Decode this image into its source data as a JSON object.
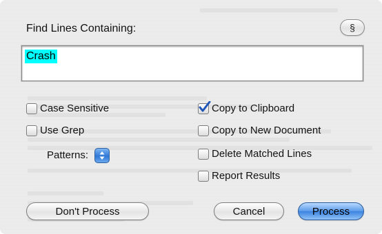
{
  "dialog": {
    "title_label": "Find Lines Containing:",
    "section_button": "§",
    "find_value": "Crash"
  },
  "options_left": {
    "case_sensitive": {
      "label": "Case Sensitive",
      "checked": false
    },
    "use_grep": {
      "label": "Use Grep",
      "checked": false
    },
    "patterns_label": "Patterns:"
  },
  "options_right": {
    "copy_to_clipboard": {
      "label": "Copy to Clipboard",
      "checked": true
    },
    "copy_to_new_document": {
      "label": "Copy to New Document",
      "checked": false
    },
    "delete_matched_lines": {
      "label": "Delete Matched Lines",
      "checked": false
    },
    "report_results": {
      "label": "Report Results",
      "checked": false
    }
  },
  "buttons": {
    "dont_process": "Don't Process",
    "cancel": "Cancel",
    "process": "Process"
  },
  "colors": {
    "selection_highlight": "#00ffff",
    "checkmark": "#1f56b8",
    "default_button": "#3b82df"
  }
}
